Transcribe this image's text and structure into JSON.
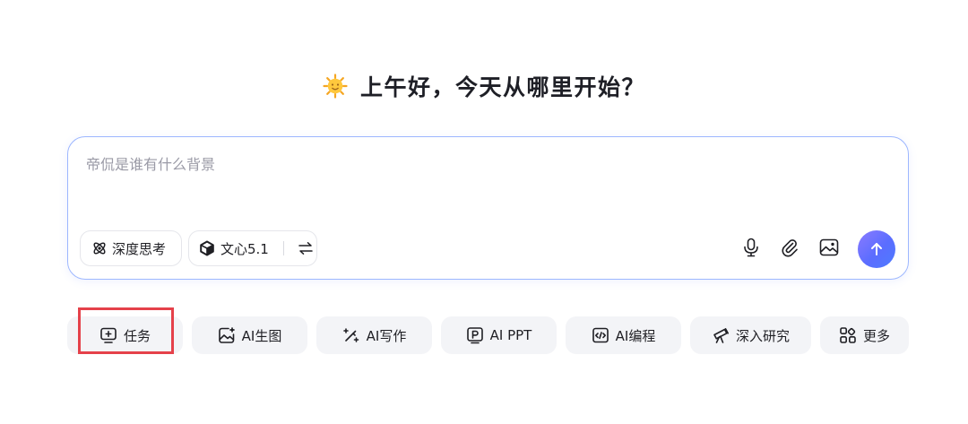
{
  "greeting": {
    "icon": "sun-emoji-icon",
    "text": "上午好，今天从哪里开始？"
  },
  "composer": {
    "placeholder": "帝侃是谁有什么背景",
    "value": "",
    "deep_think_label": "深度思考",
    "model_label": "文心5.1",
    "accent": "#9db7ff",
    "send_color": "#5b6dff"
  },
  "shortcuts": [
    {
      "label": "任务",
      "icon": "task-icon"
    },
    {
      "label": "AI生图",
      "icon": "image-generate-icon"
    },
    {
      "label": "AI写作",
      "icon": "magic-pen-icon"
    },
    {
      "label": "AI PPT",
      "icon": "ppt-icon"
    },
    {
      "label": "AI编程",
      "icon": "code-icon"
    },
    {
      "label": "深入研究",
      "icon": "telescope-icon"
    },
    {
      "label": "更多",
      "icon": "apps-grid-icon"
    }
  ],
  "highlight_color": "#e5414a"
}
